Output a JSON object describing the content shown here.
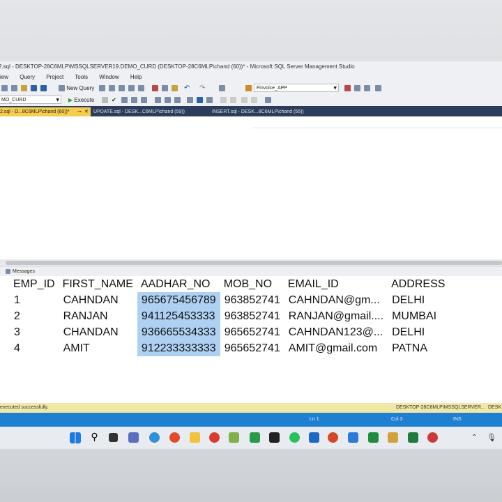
{
  "window": {
    "title": "2.sql - DESKTOP-28C6MLP\\MSSQLSERVER19.DEMO_CURD (DESKTOP-28C6MLP\\chand (60))* - Microsoft SQL Server Management Studio"
  },
  "menu": [
    "iew",
    "Query",
    "Project",
    "Tools",
    "Window",
    "Help"
  ],
  "toolbar": {
    "new_query_label": "New Query",
    "database_value": "Finvoice_APP",
    "db_selector_value": "MO_CURD",
    "execute_label": "Execute"
  },
  "tabs": [
    {
      "label": "2.sql - D...8C6MLP\\chand (60))*",
      "active": true
    },
    {
      "label": "UPDATE.sql - DESK...C6MLP\\chand (59))",
      "active": false
    },
    {
      "label": "INSERT.sql - DESK...8C6MLP\\chand (55))",
      "active": false
    }
  ],
  "results": {
    "tab_label": "Messages",
    "columns": [
      "EMP_ID",
      "FIRST_NAME",
      "AADHAR_NO",
      "MOB_NO",
      "EMAIL_ID",
      "ADDRESS"
    ],
    "rows": [
      [
        "1",
        "CAHNDAN",
        "965675456789",
        "963852741",
        "CAHNDAN@gm...",
        "DELHI"
      ],
      [
        "2",
        "RANJAN",
        "941125453333",
        "963852741",
        "RANJAN@gmail....",
        "MUMBAI"
      ],
      [
        "3",
        "CHANDAN",
        "936665534333",
        "965652741",
        "CAHNDAN123@...",
        "DELHI"
      ],
      [
        "4",
        "AMIT",
        "912233333333",
        "965652741",
        "AMIT@gmail.com",
        "PATNA"
      ]
    ]
  },
  "status": {
    "message": "executed successfully.",
    "server": "DESKTOP-28C6MLP\\MSSQLSERVER...",
    "server_clip": "DESK",
    "line": "Ln 1",
    "col": "Col 3",
    "mode": "INS"
  },
  "colors": {
    "tab_strip": "#2c3d5c",
    "active_tab": "#f5cc4e",
    "selection": "#aed0f2",
    "status_yellow": "#f0e8a6",
    "status_blue": "#1f7fd1"
  }
}
